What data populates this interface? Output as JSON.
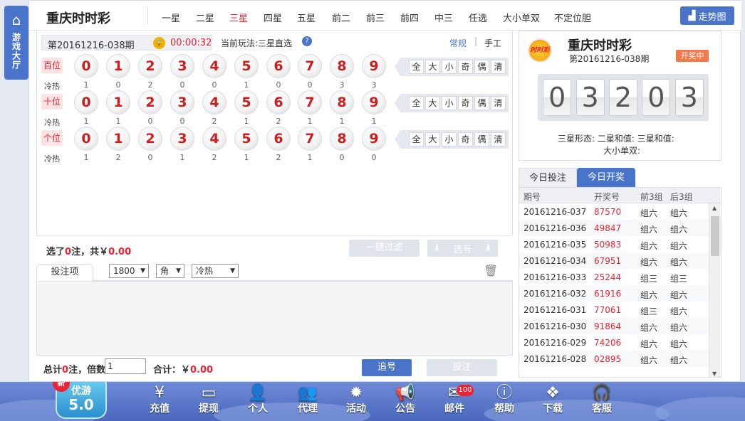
{
  "sidebar": {
    "lobby_label": "游戏大厅"
  },
  "header": {
    "title": "重庆时时彩",
    "nav": [
      "一星",
      "二星",
      "三星",
      "四星",
      "五星",
      "前二",
      "前三",
      "前四",
      "中三",
      "任选",
      "大小单双",
      "不定位胆"
    ],
    "active_nav": "三星",
    "trend_label": "走势图"
  },
  "play": {
    "issue": "第20161216-038期",
    "countdown": "00:00:32",
    "current_mode": "当前玩法:三星直选",
    "mode_normal": "常规",
    "mode_sep": "|",
    "mode_manual": "手工"
  },
  "positions": [
    {
      "label": "百位",
      "hot_label": "冷热",
      "hot": [
        "1",
        "0",
        "2",
        "0",
        "0",
        "1",
        "0",
        "0",
        "3",
        "3"
      ]
    },
    {
      "label": "十位",
      "hot_label": "冷热",
      "hot": [
        "1",
        "1",
        "0",
        "0",
        "2",
        "1",
        "2",
        "1",
        "1",
        "1"
      ]
    },
    {
      "label": "个位",
      "hot_label": "冷热",
      "hot": [
        "1",
        "2",
        "0",
        "1",
        "2",
        "1",
        "2",
        "1",
        "0",
        "0"
      ]
    }
  ],
  "balls": [
    "0",
    "1",
    "2",
    "3",
    "4",
    "5",
    "6",
    "7",
    "8",
    "9"
  ],
  "filters": [
    "全",
    "大",
    "小",
    "奇",
    "偶",
    "清"
  ],
  "selection": {
    "prefix": "选了",
    "count": "0",
    "mid": "注，共￥",
    "amount": "0.00",
    "filter_button": "一键过滤",
    "pick_button": "选号"
  },
  "bet": {
    "tab": "投注项",
    "amount_select": "1800",
    "unit_select": "角",
    "hot_select": "冷热",
    "total_prefix": "总计",
    "total_count": "0",
    "total_mid": "注，倍数",
    "multiplier": "1",
    "sum_label": "合计：￥",
    "sum_value": "0.00",
    "chase_button": "追号",
    "bet_button": "投注"
  },
  "result": {
    "logo_text": "时时彩",
    "title": "重庆时时彩",
    "issue": "第20161216-038期",
    "status": "开奖中",
    "digits": [
      "0",
      "3",
      "2",
      "0",
      "3"
    ],
    "shape": "三星形态:  二星和值:  三星和值:",
    "size": "大小单双:"
  },
  "history": {
    "tab_bet": "今日投注",
    "tab_draw": "今日开奖",
    "headers": [
      "期号",
      "开奖号",
      "前3组",
      "后3组"
    ],
    "rows": [
      [
        "20161216-037",
        "87570",
        "组六",
        "组六"
      ],
      [
        "20161216-036",
        "49847",
        "组六",
        "组六"
      ],
      [
        "20161216-035",
        "50983",
        "组六",
        "组六"
      ],
      [
        "20161216-034",
        "67951",
        "组六",
        "组六"
      ],
      [
        "20161216-033",
        "25244",
        "组三",
        "组三"
      ],
      [
        "20161216-032",
        "61916",
        "组六",
        "组六"
      ],
      [
        "20161216-031",
        "77061",
        "组三",
        "组六"
      ],
      [
        "20161216-030",
        "91864",
        "组六",
        "组六"
      ],
      [
        "20161216-029",
        "74206",
        "组六",
        "组六"
      ],
      [
        "20161216-028",
        "02895",
        "组六",
        "组六"
      ]
    ]
  },
  "bottom": {
    "app_new": "新",
    "app_name": "优游",
    "app_version": "5.0",
    "items": [
      "充值",
      "提现",
      "个人",
      "代理",
      "活动",
      "公告",
      "邮件",
      "帮助",
      "下载",
      "客服"
    ],
    "mail_badge": "100"
  },
  "colors": {
    "accent": "#4a74c9",
    "red": "#e23"
  }
}
